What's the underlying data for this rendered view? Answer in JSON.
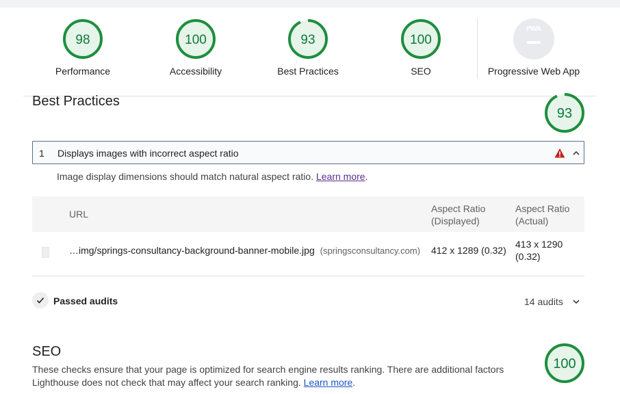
{
  "scores": [
    {
      "label": "Performance",
      "value": "98"
    },
    {
      "label": "Accessibility",
      "value": "100"
    },
    {
      "label": "Best Practices",
      "value": "93"
    },
    {
      "label": "SEO",
      "value": "100"
    }
  ],
  "pwa": {
    "label": "Progressive Web App",
    "badge_text": "PWA"
  },
  "best_practices": {
    "title": "Best Practices",
    "score": "93",
    "audit": {
      "number": "1",
      "title": "Displays images with incorrect aspect ratio",
      "description": "Image display dimensions should match natural aspect ratio.",
      "learn_more": "Learn more",
      "table": {
        "headers": {
          "url": "URL",
          "displayed_line1": "Aspect Ratio",
          "displayed_line2": "(Displayed)",
          "actual_line1": "Aspect Ratio",
          "actual_line2": "(Actual)"
        },
        "rows": [
          {
            "url": "…img/springs-consultancy-background-banner-mobile.jpg",
            "host": "(springsconsultancy.com)",
            "displayed": "412 x 1289 (0.32)",
            "actual_line1": "413 x 1290",
            "actual_line2": "(0.32)"
          }
        ]
      }
    },
    "passed": {
      "label": "Passed audits",
      "count": "14 audits"
    }
  },
  "seo": {
    "title": "SEO",
    "score": "100",
    "description": "These checks ensure that your page is optimized for search engine results ranking. There are additional factors Lighthouse does not check that may affect your search ranking.",
    "learn_more": "Learn more",
    "trailing": "."
  },
  "colors": {
    "pass": "#0c7a3a",
    "pass_ring": "#1e8e3e",
    "warn": "#c5221f"
  }
}
